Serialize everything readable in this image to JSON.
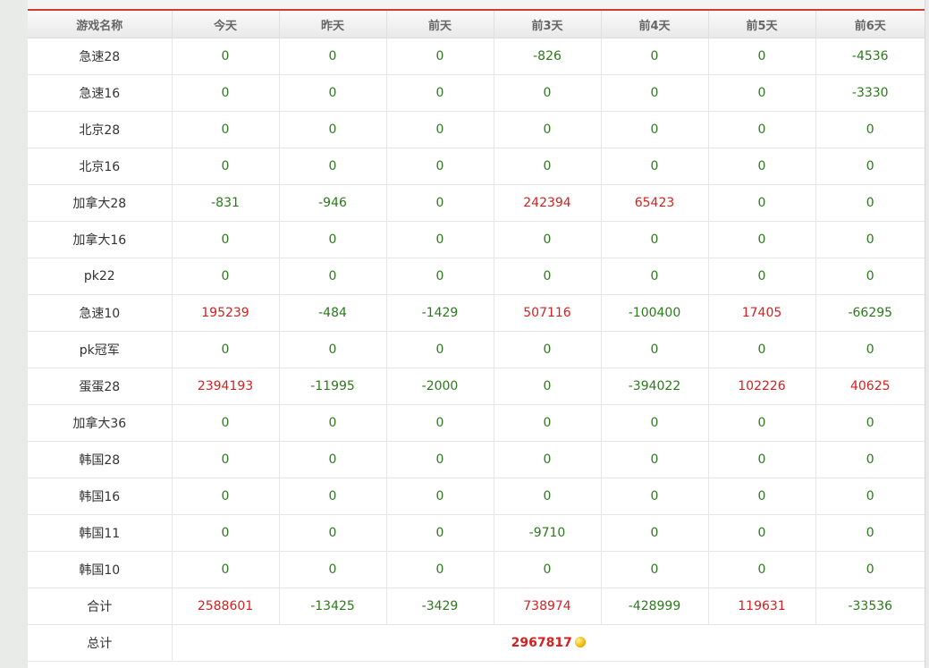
{
  "headers": [
    "游戏名称",
    "今天",
    "昨天",
    "前天",
    "前3天",
    "前4天",
    "前5天",
    "前6天"
  ],
  "rows": [
    {
      "name": "急速28",
      "values": [
        "0",
        "0",
        "0",
        "-826",
        "0",
        "0",
        "-4536"
      ]
    },
    {
      "name": "急速16",
      "values": [
        "0",
        "0",
        "0",
        "0",
        "0",
        "0",
        "-3330"
      ]
    },
    {
      "name": "北京28",
      "values": [
        "0",
        "0",
        "0",
        "0",
        "0",
        "0",
        "0"
      ]
    },
    {
      "name": "北京16",
      "values": [
        "0",
        "0",
        "0",
        "0",
        "0",
        "0",
        "0"
      ]
    },
    {
      "name": "加拿大28",
      "values": [
        "-831",
        "-946",
        "0",
        "242394",
        "65423",
        "0",
        "0"
      ]
    },
    {
      "name": "加拿大16",
      "values": [
        "0",
        "0",
        "0",
        "0",
        "0",
        "0",
        "0"
      ]
    },
    {
      "name": "pk22",
      "values": [
        "0",
        "0",
        "0",
        "0",
        "0",
        "0",
        "0"
      ]
    },
    {
      "name": "急速10",
      "values": [
        "195239",
        "-484",
        "-1429",
        "507116",
        "-100400",
        "17405",
        "-66295"
      ]
    },
    {
      "name": "pk冠军",
      "values": [
        "0",
        "0",
        "0",
        "0",
        "0",
        "0",
        "0"
      ]
    },
    {
      "name": "蛋蛋28",
      "values": [
        "2394193",
        "-11995",
        "-2000",
        "0",
        "-394022",
        "102226",
        "40625"
      ]
    },
    {
      "name": "加拿大36",
      "values": [
        "0",
        "0",
        "0",
        "0",
        "0",
        "0",
        "0"
      ]
    },
    {
      "name": "韩国28",
      "values": [
        "0",
        "0",
        "0",
        "0",
        "0",
        "0",
        "0"
      ]
    },
    {
      "name": "韩国16",
      "values": [
        "0",
        "0",
        "0",
        "0",
        "0",
        "0",
        "0"
      ]
    },
    {
      "name": "韩国11",
      "values": [
        "0",
        "0",
        "0",
        "-9710",
        "0",
        "0",
        "0"
      ]
    },
    {
      "name": "韩国10",
      "values": [
        "0",
        "0",
        "0",
        "0",
        "0",
        "0",
        "0"
      ]
    }
  ],
  "subtotal": {
    "label": "合计",
    "values": [
      "2588601",
      "-13425",
      "-3429",
      "738974",
      "-428999",
      "119631",
      "-33536"
    ]
  },
  "total": {
    "label": "总计",
    "value": "2967817",
    "icon": "coin-icon"
  },
  "colors": {
    "positive": "#d42020",
    "non_positive": "#2a7a1a",
    "accent_line": "#d33a2c"
  }
}
